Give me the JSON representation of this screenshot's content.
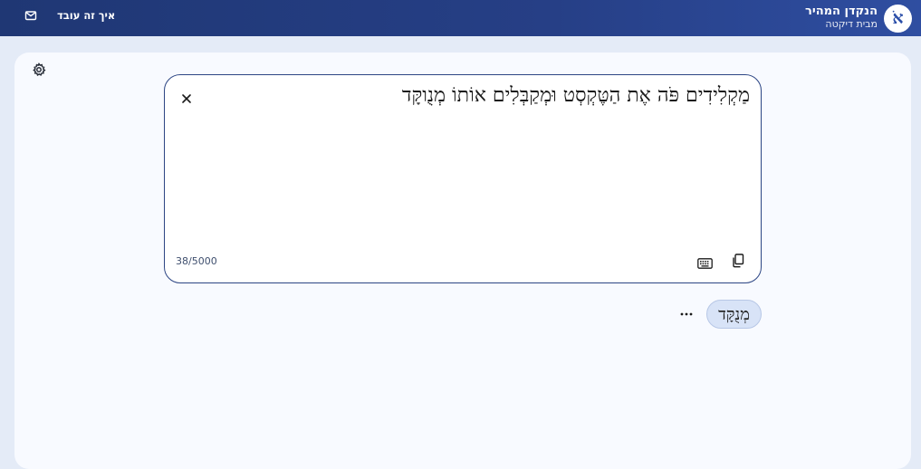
{
  "header": {
    "logo_letter": "אֹ",
    "title": "הנקדן המהיר",
    "subtitle": "מבית דיקטה",
    "how_link": "איך זה עובד",
    "mail_icon": "mail-icon"
  },
  "editor": {
    "text": "מַקְלִידִים פֹּה אֶת הַטֶּקְסְט וּמְקַבְּלִים אוֹתוֹ מְנֻוקָּד",
    "char_count": "38/5000",
    "icons": {
      "clear": "close-icon",
      "keyboard": "keyboard-icon",
      "copy": "copy-icon",
      "settings": "gear-icon"
    }
  },
  "suggestion": {
    "word": "מְנֻקָּד",
    "more_icon": "more-dots-icon"
  },
  "colors": {
    "header_gradient_start": "#1f3774",
    "header_gradient_end": "#2f4ea1",
    "page_bg": "#e4ebf7",
    "card_bg": "#f8faff",
    "editor_border": "#2c4584",
    "chip_bg": "#d8e3f7"
  }
}
